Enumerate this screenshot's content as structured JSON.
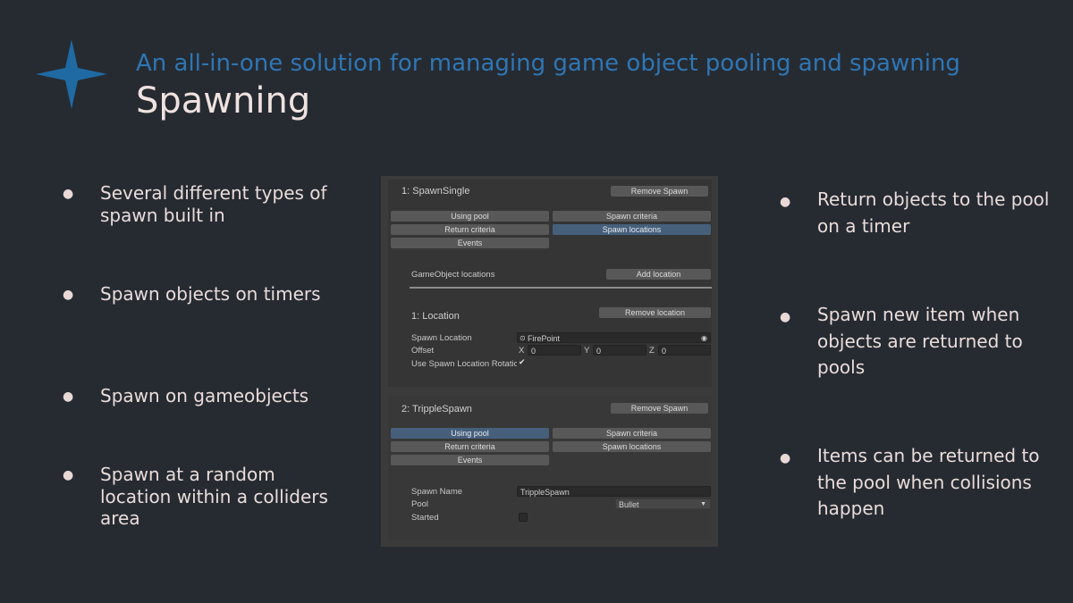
{
  "slide": {
    "subtitle": "An all-in-one solution for managing game object pooling and spawning",
    "title": "Spawning",
    "colors": {
      "background": "#262b32",
      "accent": "#2f76b4",
      "text": "#eadcd9"
    },
    "icon": "four-point-star-icon"
  },
  "left_bullets": [
    "Several different types of spawn built in",
    "Spawn objects on timers",
    "Spawn on gameobjects",
    "Spawn at a random location within a colliders area"
  ],
  "right_bullets": [
    "Return objects to the pool on a timer",
    "Spawn new item when objects are returned to pools",
    "Items can be returned to the pool when collisions happen"
  ],
  "inspector": {
    "spawn1": {
      "header": "1: SpawnSingle",
      "remove_label": "Remove Spawn",
      "tabs": [
        "Using pool",
        "Spawn criteria",
        "Return criteria",
        "Spawn locations",
        "Events"
      ],
      "locations_label": "GameObject locations",
      "add_location_label": "Add location",
      "location_header": "1: Location",
      "remove_location_label": "Remove location",
      "spawn_location_label": "Spawn Location",
      "spawn_location_value": "FirePoint",
      "offset_label": "Offset",
      "x_label": "X",
      "x_value": "0",
      "y_label": "Y",
      "y_value": "0",
      "z_label": "Z",
      "z_value": "0",
      "use_rotation_label": "Use Spawn Location Rotatio"
    },
    "spawn2": {
      "header": "2: TrippleSpawn",
      "remove_label": "Remove Spawn",
      "tabs": [
        "Using pool",
        "Spawn criteria",
        "Return criteria",
        "Spawn locations",
        "Events"
      ],
      "spawn_name_label": "Spawn Name",
      "spawn_name_value": "TrippleSpawn",
      "pool_label": "Pool",
      "pool_value": "Bullet",
      "started_label": "Started"
    }
  }
}
